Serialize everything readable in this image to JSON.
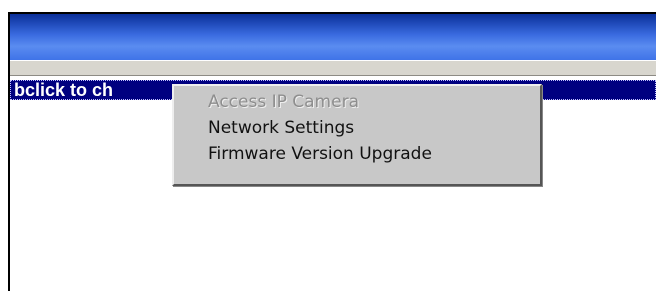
{
  "window": {
    "selected_item_text": "bclick to ch"
  },
  "context_menu": {
    "items": [
      {
        "label": "Access IP Camera",
        "enabled": false
      },
      {
        "label": "Network Settings",
        "enabled": true
      },
      {
        "label": "Firmware Version  Upgrade",
        "enabled": true
      }
    ]
  },
  "colors": {
    "titlebar": "#3a6be0",
    "selection": "#000080",
    "menu_background": "#c8c8c8",
    "disabled_text": "#8e8e8e"
  }
}
